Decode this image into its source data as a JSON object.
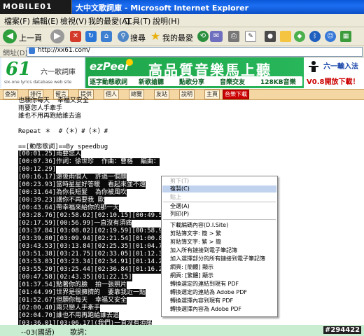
{
  "titlebar": {
    "logo": "MOBILE01",
    "title": "大中文歌詞庫 - Microsoft Internet Explorer"
  },
  "menubar": {
    "items": [
      "檔案(F)",
      "編輯(E)",
      "檢視(V)",
      "我的最愛(A)",
      "工具(T)",
      "說明(H)"
    ]
  },
  "toolbar": {
    "back": "上一頁",
    "search": "搜尋",
    "favorites": "我的最愛"
  },
  "address": {
    "label": "網址(D)",
    "url": "http://xx61.com/"
  },
  "banner": {
    "logo_num": "61",
    "logo_cn": "六一歌詞庫",
    "logo_sub": "six-one lyrics database web site",
    "ad_brand": "ezPeer",
    "ad_headline": "高品質音樂馬上聽",
    "ad_tags": [
      "逐字動態歌詞",
      "新歌搶聽",
      "點歌分享",
      "音樂交友",
      "128KB音樂"
    ],
    "right_top": "六一輸入法",
    "right_bottom": "V0.8開放下載！"
  },
  "nav": {
    "items": [
      "查詢",
      "排行",
      "留言",
      "提供",
      "個人",
      "總覽",
      "友站",
      "說明",
      "主頁",
      "音樂下載"
    ]
  },
  "lyrics": {
    "plain_lines": [
      "也願你每天  幸福又安全",
      "雨要您人手牽手",
      "誰也不用再跑給誰去追",
      "",
      "Repeat ＊  #（＊）#（＊）#",
      "",
      "==[動態歌詞]==By speedbug"
    ],
    "timed_lines": [
      "[00:01.25]雨要您人",
      "[00:07.36]作詞：徐世珍  作曲：曹格  編曲：",
      "[00:12.29]",
      "[00:16.17]遠後雨個人  許過一個願",
      "[00:23.93]當時星星好答暖  看起來並不遠",
      "[00:31.64]為你長短髮  為你被風吹",
      "[00:39.23]講你不再要我 歐",
      "[00:43.64]帶幸福來給你的那一天",
      "[03:28.76][02:58.62][02:10.15][00:49.59]拿",
      "[02:17.59][00:56.99]一直沒有須痛",
      "[03:37.84][03:08.02][02:19.59][00:58.90]一直",
      "[03:39.80][03:09.94][02:21.54][01:00.86]讓",
      "[03:43.53][03:13.84][02:25.35][01:04.77]冬天",
      "[03:51.38][03:21.75][02:33.05][01:12.37]一直",
      "[03:53.03][03:23.34][02:34.91][01:14.23]一直",
      "[03:55.20][03:25.44][02:36.84][01:16.23]你  就負責靠我的肩",
      "[00:47.58][02:43.35][01:22.15]",
      "[01:37.54]點著你的臉  拍一張照片",
      "[01:44.99]世界是很擁擠的  要靠我近一點",
      "[01:52.67]但願你每天  幸福又安全",
      "[02:00.40]兩只戀人手牽手",
      "[02:04.70]誰也不用再跑給誰去追",
      "[03:36.01][03:06.17](我們)一直沒有須痛"
    ]
  },
  "bottom": {
    "text": "--03(國語)       歌詞：",
    "watermark": "#294422"
  },
  "context_menu": {
    "items": [
      "剪下(T)",
      "複製(C)",
      "貼上",
      "全選(A)",
      "列印(P)",
      "下載編碼內容(D.I.Site)",
      "剪貼簿文字: 簡 > 繁",
      "剪貼簿文字: 繁 > 簡",
      "加入所有鏈接到電子筆記簿",
      "加入選擇部分的所有鏈接到電子筆記簿",
      "網頁: [簡體] 顯示",
      "網頁: [繁體] 顯示",
      "轉換選定的連結到現有 PDF",
      "轉換選定的連結為 Adobe PDF",
      "轉換選擇內容到現有 PDF",
      "轉換選擇內容為 Adobe PDF"
    ]
  },
  "colors": {
    "titlebar": "#0a58d8",
    "selection": "#0a0a0a",
    "ad_green": "#1fa64b",
    "nav_bg": "#f5d7a4",
    "bottom_bar": "#c9edd0",
    "menu_highlight": "#c1d2ee"
  }
}
